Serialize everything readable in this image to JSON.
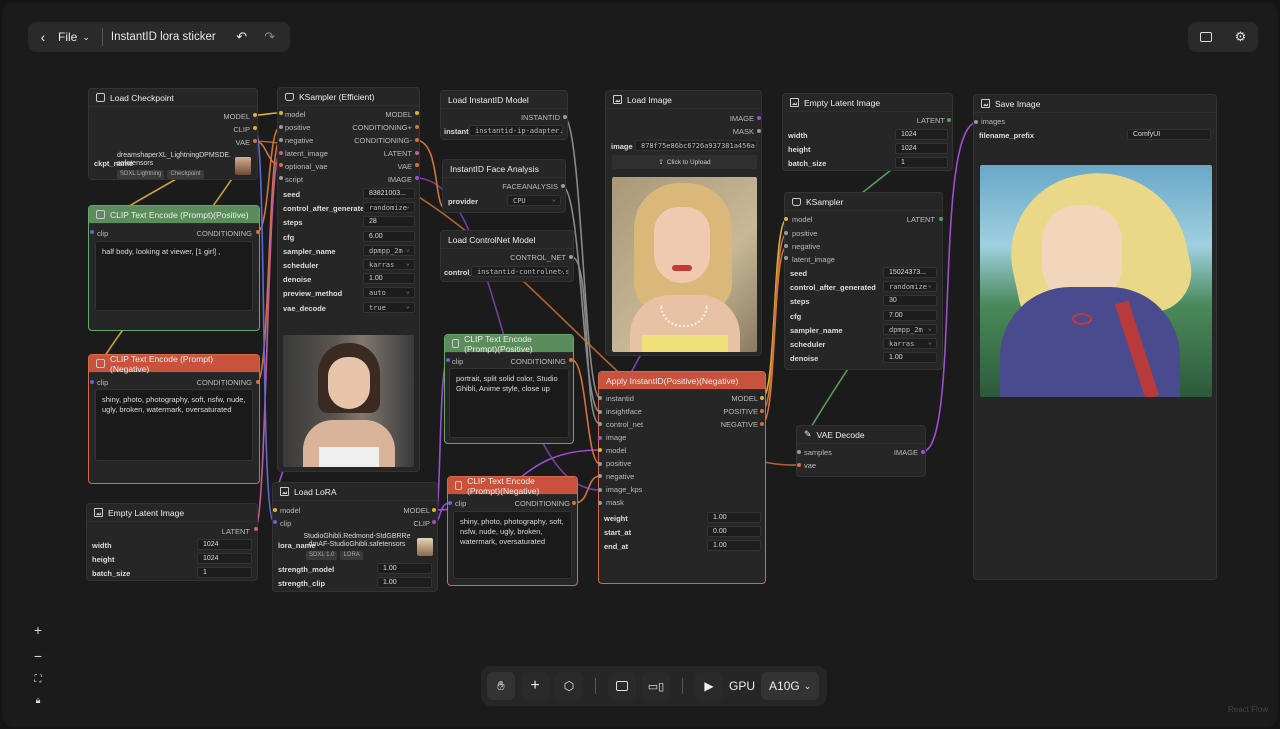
{
  "topbar": {
    "file_label": "File",
    "title": "InstantID lora sticker"
  },
  "bottombar": {
    "gpu_label": "GPU",
    "gpu_value": "A10G"
  },
  "watermark": "React Flow",
  "nodes": {
    "load_checkpoint": {
      "title": "Load Checkpoint",
      "outputs": [
        "MODEL",
        "CLIP",
        "VAE"
      ],
      "widget_label": "ckpt_name",
      "ckpt_value": "dreamshaperXL_LightningDPMSDE.safetensors",
      "tags": [
        "SDXL Lightning",
        "Checkpoint"
      ]
    },
    "clip_pos": {
      "title": "CLIP Text Encode (Prompt)(Positive)",
      "input": "clip",
      "output": "CONDITIONING",
      "text": "half body, looking at viewer, [1 girl] ,"
    },
    "clip_neg": {
      "title": "CLIP Text Encode (Prompt)(Negative)",
      "input": "clip",
      "output": "CONDITIONING",
      "text": "shiny, photo, photography, soft, nsfw, nude, ugly, broken, watermark, oversaturated"
    },
    "empty_latent_left": {
      "title": "Empty Latent Image",
      "output": "LATENT",
      "widgets": [
        {
          "label": "width",
          "value": "1024"
        },
        {
          "label": "height",
          "value": "1024"
        },
        {
          "label": "batch_size",
          "value": "1"
        }
      ]
    },
    "ksampler_eff": {
      "title": "KSampler (Efficient)",
      "inputs": [
        "model",
        "positive",
        "negative",
        "latent_image",
        "optional_vae",
        "script"
      ],
      "outputs": [
        "MODEL",
        "CONDITIONING+",
        "CONDITIONING-",
        "LATENT",
        "VAE",
        "IMAGE"
      ],
      "widgets": [
        {
          "label": "seed",
          "value": "83821003..."
        },
        {
          "label": "control_after_generated",
          "value": "randomize"
        },
        {
          "label": "steps",
          "value": "28"
        },
        {
          "label": "cfg",
          "value": "6.00"
        },
        {
          "label": "sampler_name",
          "value": "dpmpp_2m"
        },
        {
          "label": "scheduler",
          "value": "karras"
        },
        {
          "label": "denoise",
          "value": "1.00"
        },
        {
          "label": "preview_method",
          "value": "auto"
        },
        {
          "label": "vae_decode",
          "value": "true"
        }
      ]
    },
    "load_lora": {
      "title": "Load LoRA",
      "inputs": [
        "model",
        "clip"
      ],
      "outputs": [
        "MODEL",
        "CLIP"
      ],
      "widget_label": "lora_name",
      "lora_value": "StudioGhibli.Redmond-StdGBRRedmAF-StudioGhibli.safetensors",
      "tags": [
        "SDXL 1.0",
        "LORA"
      ],
      "widgets": [
        {
          "label": "strength_model",
          "value": "1.00"
        },
        {
          "label": "strength_clip",
          "value": "1.00"
        }
      ]
    },
    "load_instantid": {
      "title": "Load InstantID Model",
      "output": "INSTANTID",
      "widget_label": "instantid",
      "widget_value": "instantid-ip-adapter..."
    },
    "face_analysis": {
      "title": "InstantID Face Analysis",
      "output": "FACEANALYSIS",
      "widget_label": "provider",
      "widget_value": "CPU"
    },
    "load_controlnet": {
      "title": "Load ControlNet Model",
      "output": "CONTROL_NET",
      "widget_label": "control_net",
      "widget_value": "instantid-controlnet.s..."
    },
    "clip_pos2": {
      "title": "CLIP Text Encode (Prompt)(Positive)",
      "input": "clip",
      "output": "CONDITIONING",
      "text": "portrait, split solid color, Studio Ghibli, Anime style, close up"
    },
    "clip_neg2": {
      "title": "CLIP Text Encode (Prompt)(Negative)",
      "input": "clip",
      "output": "CONDITIONING",
      "text": "shiny, photo, photography, soft, nsfw, nude, ugly, broken, watermark, oversaturated"
    },
    "load_image": {
      "title": "Load Image",
      "outputs": [
        "IMAGE",
        "MASK"
      ],
      "widget_label": "image",
      "widget_value": "878f75e86bc6726a937381a456a...",
      "upload_label": "Click to Upload"
    },
    "apply_instantid": {
      "title": "Apply InstantID(Positive)(Negative)",
      "inputs": [
        "instantid",
        "insightface",
        "control_net",
        "image",
        "model",
        "positive",
        "negative",
        "image_kps",
        "mask"
      ],
      "outputs": [
        "MODEL",
        "POSITIVE",
        "NEGATIVE"
      ],
      "widgets": [
        {
          "label": "weight",
          "value": "1.00"
        },
        {
          "label": "start_at",
          "value": "0.00"
        },
        {
          "label": "end_at",
          "value": "1.00"
        }
      ]
    },
    "empty_latent_right": {
      "title": "Empty Latent Image",
      "output": "LATENT",
      "widgets": [
        {
          "label": "width",
          "value": "1024"
        },
        {
          "label": "height",
          "value": "1024"
        },
        {
          "label": "batch_size",
          "value": "1"
        }
      ]
    },
    "ksampler": {
      "title": "KSampler",
      "inputs": [
        "model",
        "positive",
        "negative",
        "latent_image"
      ],
      "output": "LATENT",
      "widgets": [
        {
          "label": "seed",
          "value": "15024373..."
        },
        {
          "label": "control_after_generated",
          "value": "randomize"
        },
        {
          "label": "steps",
          "value": "30"
        },
        {
          "label": "cfg",
          "value": "7.00"
        },
        {
          "label": "sampler_name",
          "value": "dpmpp_2m"
        },
        {
          "label": "scheduler",
          "value": "karras"
        },
        {
          "label": "denoise",
          "value": "1.00"
        }
      ]
    },
    "vae_decode": {
      "title": "VAE Decode",
      "inputs": [
        "samples",
        "vae"
      ],
      "output": "IMAGE"
    },
    "save_image": {
      "title": "Save Image",
      "input": "images",
      "widget_label": "filename_prefix",
      "widget_value": "ComfyUI"
    }
  },
  "colors": {
    "canvas": "#1b1b1b",
    "node": "#262626",
    "green": "#5b8c5b",
    "red": "#c8523c",
    "wire_yellow": "#d8b23a",
    "wire_purple": "#9a4fd1",
    "wire_orange": "#d2733c",
    "wire_gray": "#8a8a8a",
    "wire_pink": "#c45b9a",
    "wire_green": "#5a9a5a",
    "wire_blue": "#5a6ad1"
  }
}
